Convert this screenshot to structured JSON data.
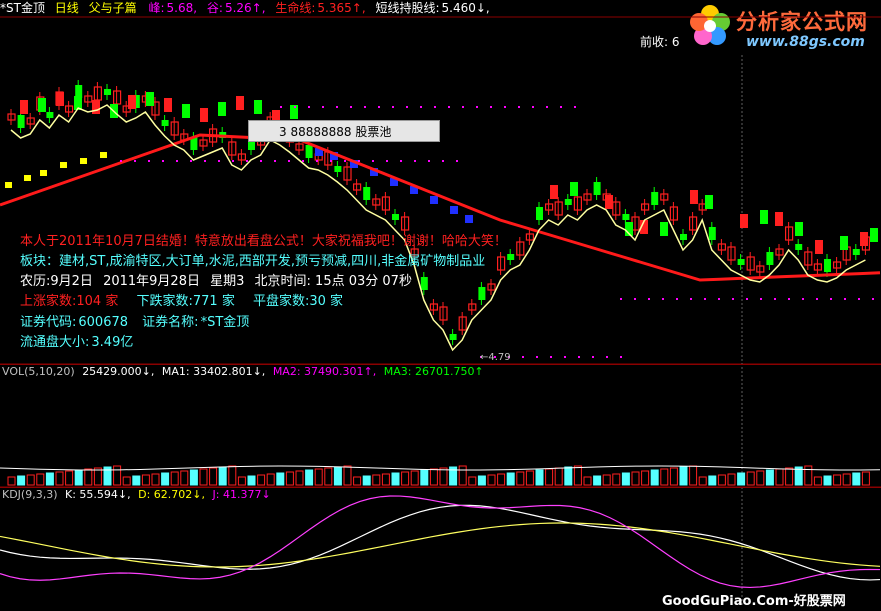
{
  "header": {
    "stock": "*ST金顶",
    "period": "日线",
    "formula": "父与子篇",
    "peak_label": "峰:",
    "peak_value": "5.68,",
    "valley_label": "谷:",
    "valley_value": "5.26↑,",
    "lifeline_label": "生命线:",
    "lifeline_value": "5.365↑,",
    "shortline_label": "短线持股线:",
    "shortline_value": "5.460↓,"
  },
  "logo": {
    "title": "分析家公式网",
    "url": "www.88gs.com"
  },
  "qianshou": "前收: 6",
  "tooltip": "3 88888888 股票池",
  "overlay": {
    "greeting": "本人于2011年10月7日结婚！特意放出看盘公式！大家祝福我吧！谢谢！哈哈大笑！",
    "sector_label": "板块：",
    "sectors": "建材,ST,成渝特区,大订单,水泥,西部开发,预亏预减,四川,非金属矿物制品业",
    "lunar": "农历:9月2日",
    "date": "2011年9月28日",
    "weekday": "星期3",
    "bj_time": "北京时间: 15点 03分 07秒",
    "up_label": "上涨家数:",
    "up_value": "104 家",
    "down_label": "下跌家数:",
    "down_value": "771 家",
    "flat_label": "平盘家数:",
    "flat_value": "30 家",
    "code_label": "证券代码:",
    "code_value": "600678",
    "name_label": "证券名称:",
    "name_value": "*ST金顶",
    "float_label": "流通盘大小:",
    "float_value": "3.49亿"
  },
  "low_marker": "←4.79",
  "vol": {
    "label": "VOL(5,10,20)",
    "vol_value": "25429.000↓,",
    "ma1": "MA1: 33402.801↓,",
    "ma2": "MA2: 37490.301↑,",
    "ma3": "MA3: 26701.750↑"
  },
  "kdj": {
    "label": "KDJ(9,3,3)",
    "k": "K: 55.594↓,",
    "d": "D: 62.702↓,",
    "j": "J: 41.377↓"
  },
  "watermark": "GoodGuPiao.Com-好股票网",
  "colors": {
    "up": "#ff2020",
    "down": "#00ff00",
    "yellow": "#ffff00",
    "cyan": "#55ffff",
    "magenta": "#ff00ff",
    "white": "#ffffff"
  }
}
